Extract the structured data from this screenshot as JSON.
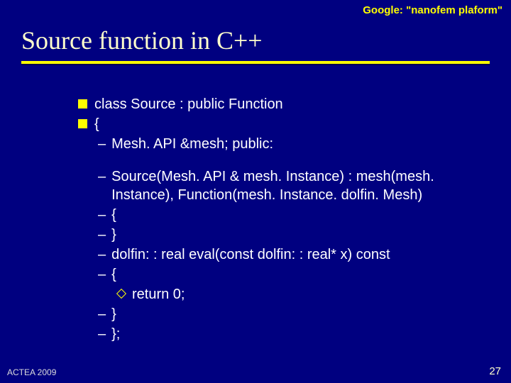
{
  "header": {
    "label": "Google: \"nanofem plaform\""
  },
  "title": "Source function in C++",
  "lines": {
    "l1": "class Source : public Function",
    "l2": "{",
    "l3": "Mesh. API &mesh; public:",
    "l4": "Source(Mesh. API & mesh. Instance) : mesh(mesh. Instance), Function(mesh. Instance. dolfin. Mesh)",
    "l5": "{",
    "l6": "}",
    "l7": "dolfin: : real eval(const dolfin: : real* x) const",
    "l8": "{",
    "l9": "return 0;",
    "l10": "}",
    "l11": "};"
  },
  "footer": {
    "left": "ACTEA 2009",
    "right": "27"
  }
}
